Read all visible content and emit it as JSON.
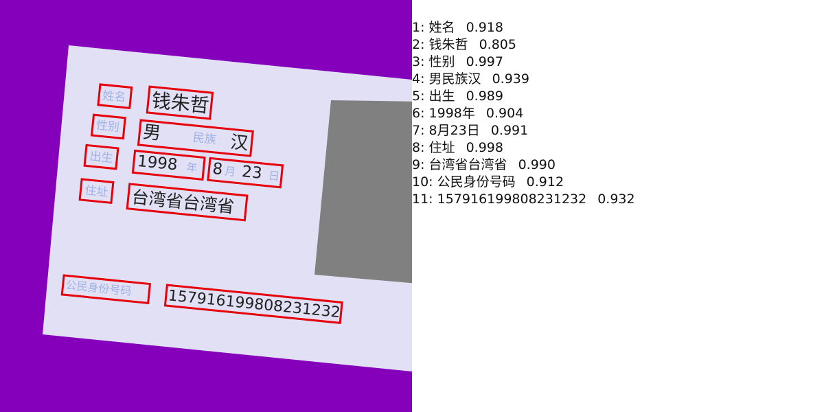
{
  "colors": {
    "background": "#8400bb",
    "card": "#e1e0f5",
    "photo": "#808080",
    "box": "#e6000a",
    "label_text": "#9fb3e6",
    "value_text": "#222222"
  },
  "card": {
    "name_label": "姓名",
    "name_value": "钱朱哲",
    "gender_label": "性别",
    "gender_value": "男",
    "ethnicity_label": "民族",
    "ethnicity_value": "汉",
    "birth_label": "出生",
    "birth_year": "1998",
    "year_char": "年",
    "birth_month": "8",
    "month_char": "月",
    "birth_day": "23",
    "day_char": "日",
    "address_label": "住址",
    "address_value": "台湾省台湾省",
    "id_label": "公民身份号码",
    "id_value": "157916199808231232"
  },
  "results": [
    {
      "index": "1:",
      "text": "姓名",
      "score": "0.918"
    },
    {
      "index": "2:",
      "text": "钱朱哲",
      "score": "0.805"
    },
    {
      "index": "3:",
      "text": "性别",
      "score": "0.997"
    },
    {
      "index": "4:",
      "text": "男民族汉",
      "score": "0.939"
    },
    {
      "index": "5:",
      "text": "出生",
      "score": "0.989"
    },
    {
      "index": "6:",
      "text": "1998年",
      "score": "0.904"
    },
    {
      "index": "7:",
      "text": "8月23日",
      "score": "0.991"
    },
    {
      "index": "8:",
      "text": "住址",
      "score": "0.998"
    },
    {
      "index": "9:",
      "text": "台湾省台湾省",
      "score": "0.990"
    },
    {
      "index": "10:",
      "text": "公民身份号码",
      "score": "0.912"
    },
    {
      "index": "11:",
      "text": "157916199808231232",
      "score": "0.932"
    }
  ]
}
